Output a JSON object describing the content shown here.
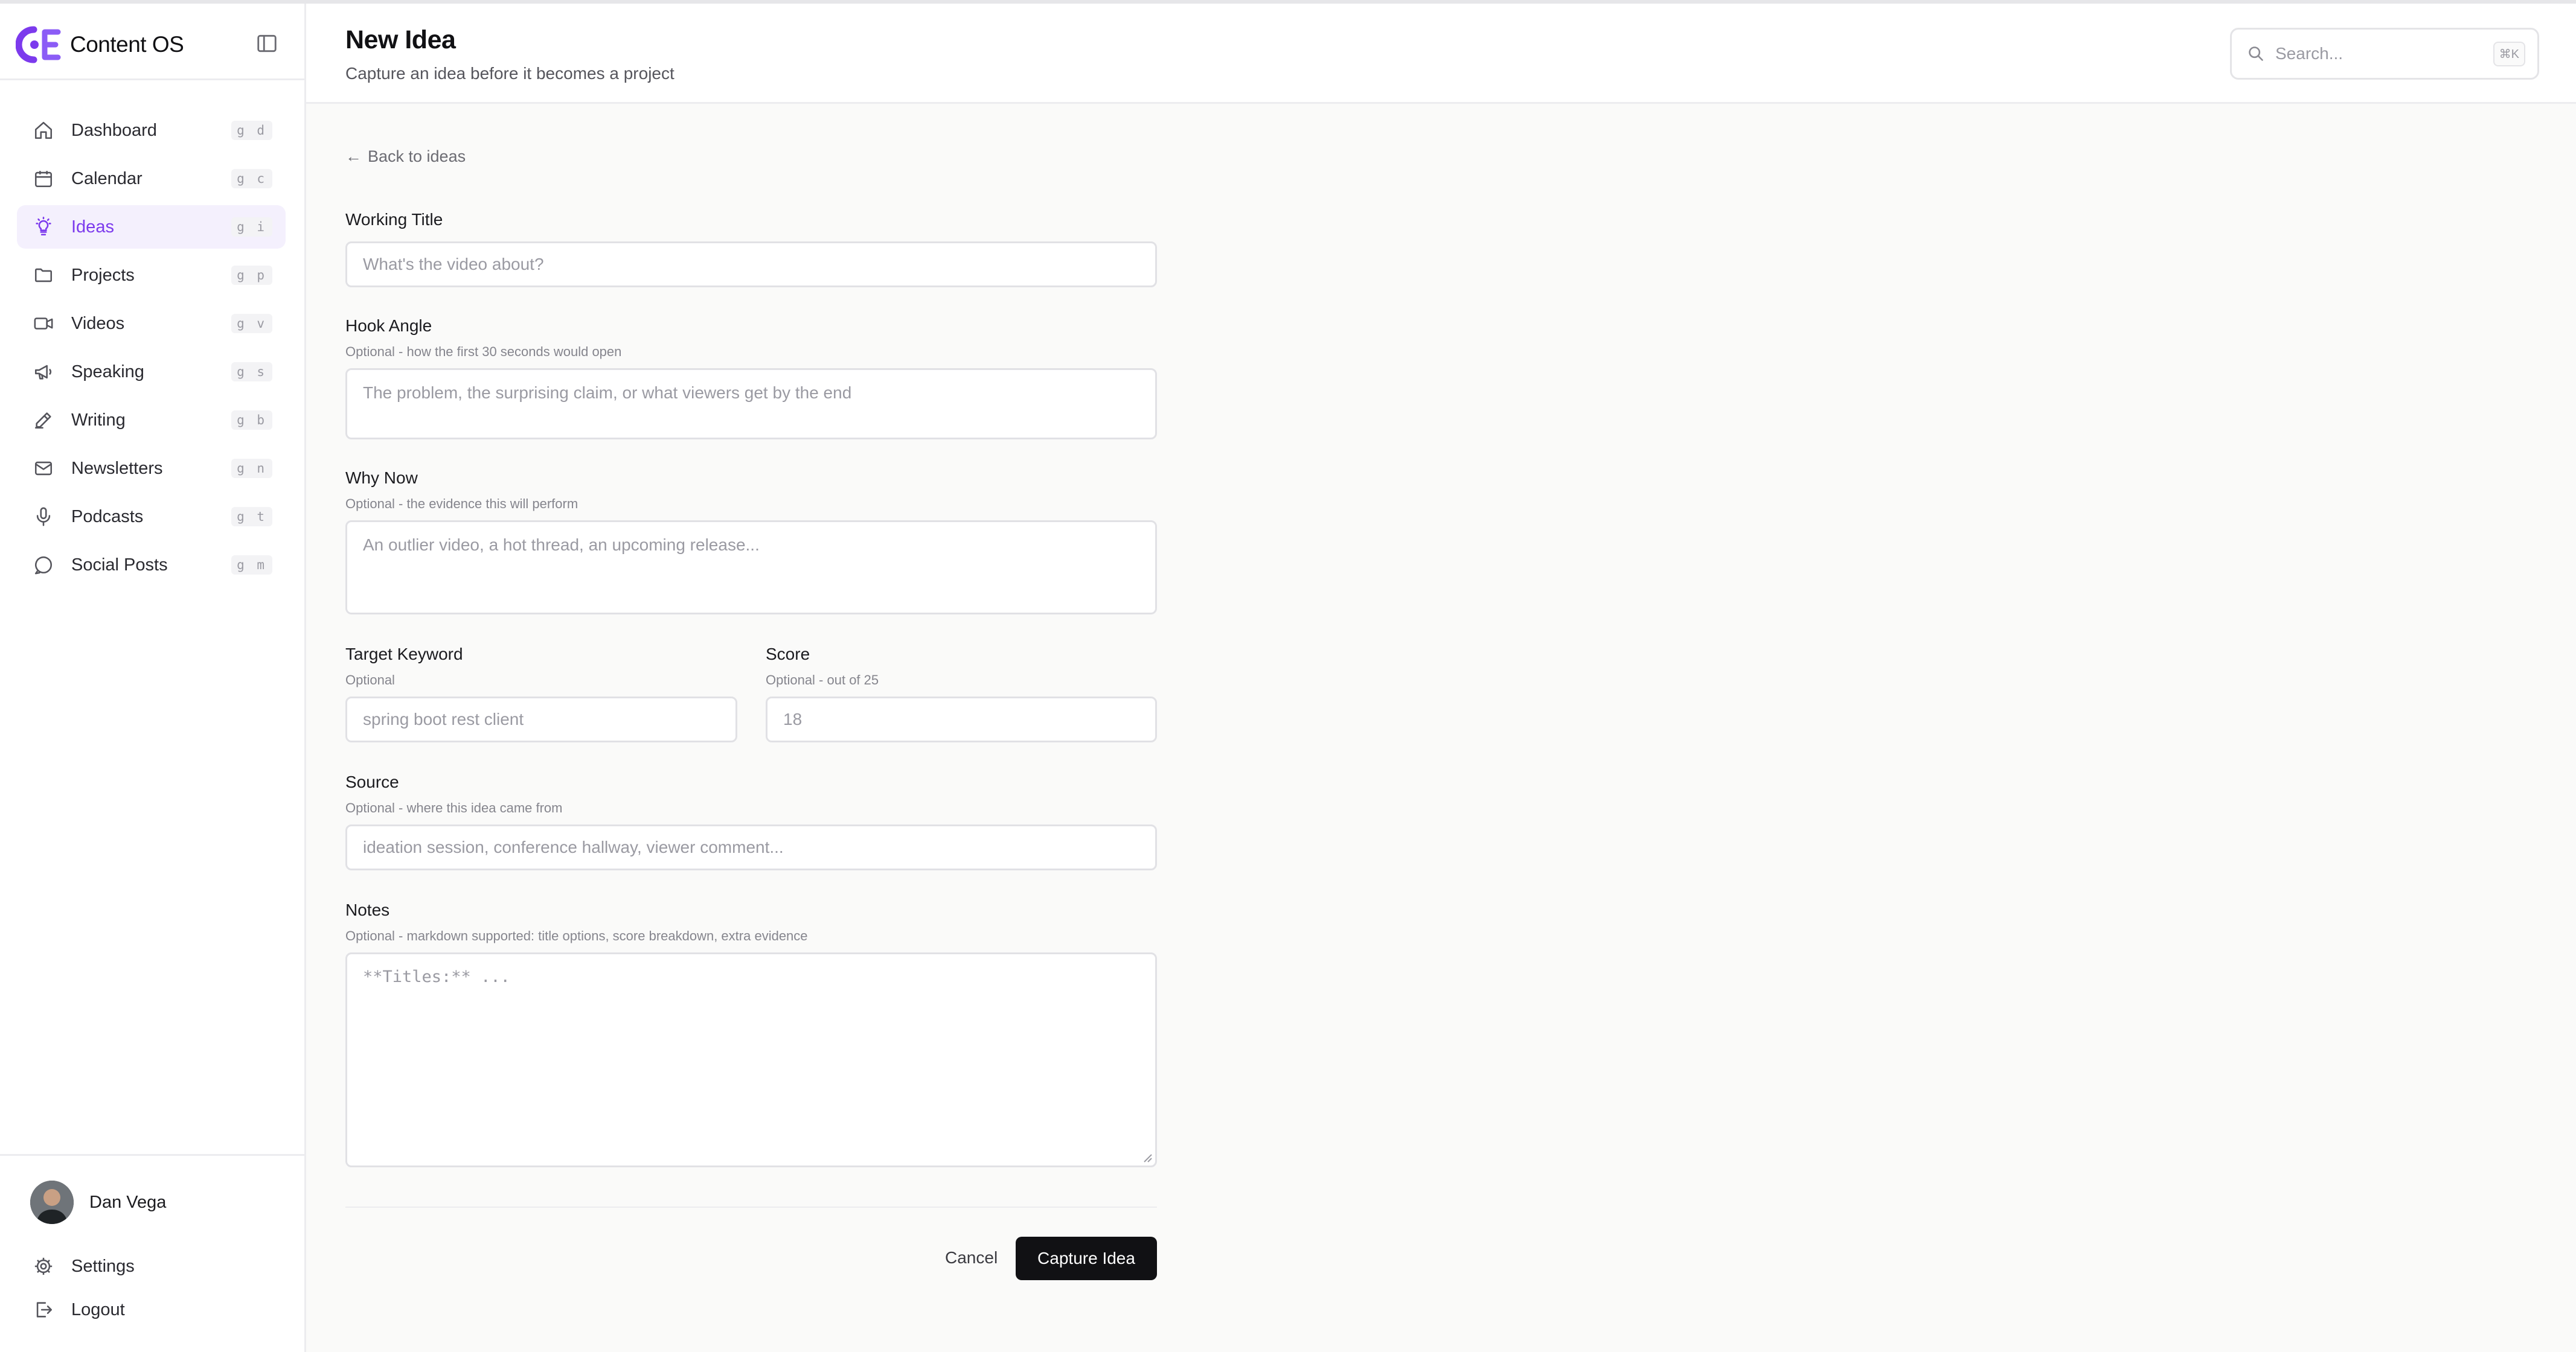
{
  "app": {
    "name": "Content OS",
    "accent": "#7c3aed"
  },
  "sidebar": {
    "items": [
      {
        "label": "Dashboard",
        "shortcut": "g d",
        "icon": "home-icon"
      },
      {
        "label": "Calendar",
        "shortcut": "g c",
        "icon": "calendar-icon"
      },
      {
        "label": "Ideas",
        "shortcut": "g i",
        "icon": "lightbulb-icon",
        "active": true
      },
      {
        "label": "Projects",
        "shortcut": "g p",
        "icon": "folder-icon"
      },
      {
        "label": "Videos",
        "shortcut": "g v",
        "icon": "video-icon"
      },
      {
        "label": "Speaking",
        "shortcut": "g s",
        "icon": "megaphone-icon"
      },
      {
        "label": "Writing",
        "shortcut": "g b",
        "icon": "pencil-icon"
      },
      {
        "label": "Newsletters",
        "shortcut": "g n",
        "icon": "mail-icon"
      },
      {
        "label": "Podcasts",
        "shortcut": "g t",
        "icon": "microphone-icon"
      },
      {
        "label": "Social Posts",
        "shortcut": "g m",
        "icon": "message-icon"
      }
    ],
    "user": {
      "name": "Dan Vega"
    },
    "footer": {
      "settings_label": "Settings",
      "logout_label": "Logout"
    }
  },
  "header": {
    "title": "New Idea",
    "subtitle": "Capture an idea before it becomes a project",
    "search": {
      "placeholder": "Search...",
      "shortcut": "⌘K"
    }
  },
  "form": {
    "back_label": "Back to ideas",
    "working_title": {
      "label": "Working Title",
      "placeholder": "What's the video about?"
    },
    "hook_angle": {
      "label": "Hook Angle",
      "hint": "Optional - how the first 30 seconds would open",
      "placeholder": "The problem, the surprising claim, or what viewers get by the end"
    },
    "why_now": {
      "label": "Why Now",
      "hint": "Optional - the evidence this will perform",
      "placeholder": "An outlier video, a hot thread, an upcoming release..."
    },
    "target_keyword": {
      "label": "Target Keyword",
      "hint": "Optional",
      "placeholder": "spring boot rest client"
    },
    "score": {
      "label": "Score",
      "hint": "Optional - out of 25",
      "placeholder": "18"
    },
    "source": {
      "label": "Source",
      "hint": "Optional - where this idea came from",
      "placeholder": "ideation session, conference hallway, viewer comment..."
    },
    "notes": {
      "label": "Notes",
      "hint": "Optional - markdown supported: title options, score breakdown, extra evidence",
      "placeholder": "**Titles:** ..."
    },
    "cancel_label": "Cancel",
    "submit_label": "Capture Idea"
  }
}
